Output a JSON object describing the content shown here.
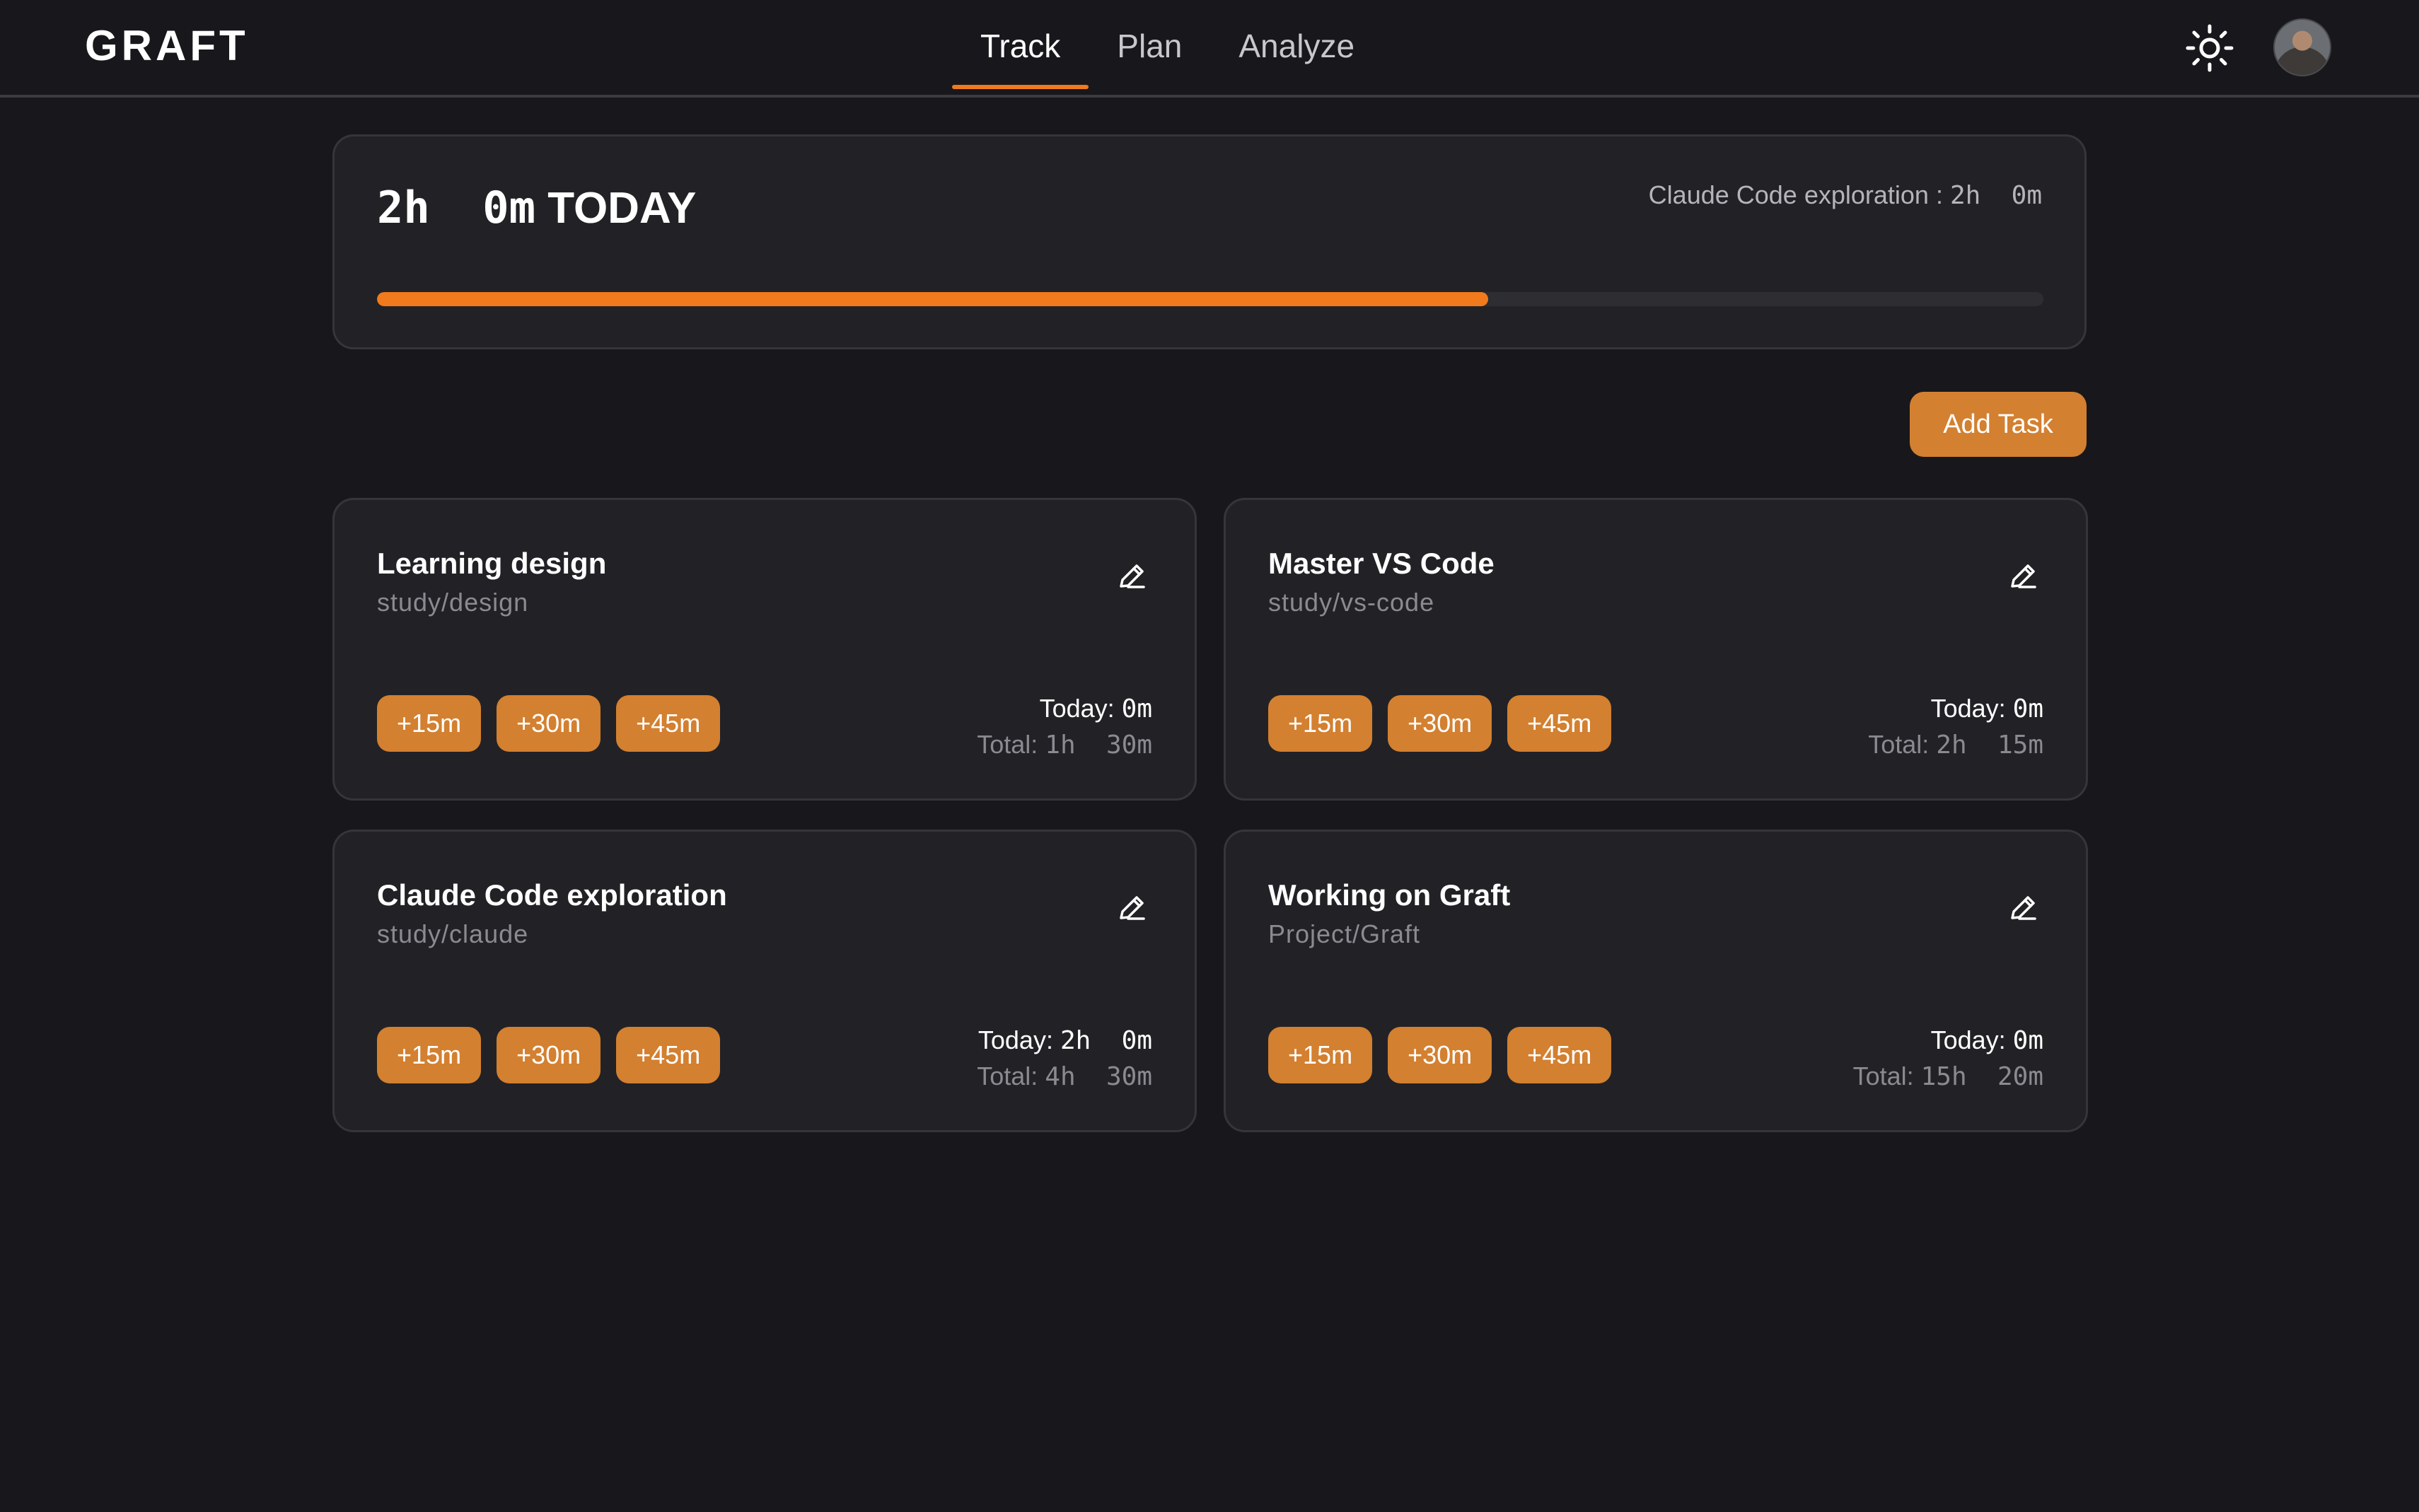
{
  "app": {
    "logo": "GRAFT"
  },
  "nav": {
    "tabs": [
      "Track",
      "Plan",
      "Analyze"
    ],
    "active": "Track"
  },
  "icons": {
    "theme": "sun-icon",
    "edit": "pencil-icon",
    "avatar": "user-avatar"
  },
  "colors": {
    "accent": "#f07a1c",
    "button": "#d38030",
    "background": "#18181c",
    "card": "#222226"
  },
  "summary": {
    "total": "2h  0m",
    "suffix": "TODAY",
    "current_label": "Claude Code exploration : ",
    "current_value": "2h  0m",
    "progress_fraction": 0.667
  },
  "actions": {
    "add_task": "Add Task"
  },
  "tasks": [
    {
      "title": "Learning design",
      "path": "study/design",
      "chips": [
        "+15m",
        "+30m",
        "+45m"
      ],
      "today_label": "Today: ",
      "today_value": "0m",
      "total_label": "Total: ",
      "total_value": "1h  30m"
    },
    {
      "title": "Master VS Code",
      "path": "study/vs-code",
      "chips": [
        "+15m",
        "+30m",
        "+45m"
      ],
      "today_label": "Today: ",
      "today_value": "0m",
      "total_label": "Total: ",
      "total_value": "2h  15m"
    },
    {
      "title": "Claude Code exploration",
      "path": "study/claude",
      "chips": [
        "+15m",
        "+30m",
        "+45m"
      ],
      "today_label": "Today: ",
      "today_value": "2h  0m",
      "total_label": "Total: ",
      "total_value": "4h  30m"
    },
    {
      "title": "Working on Graft",
      "path": "Project/Graft",
      "chips": [
        "+15m",
        "+30m",
        "+45m"
      ],
      "today_label": "Today: ",
      "today_value": "0m",
      "total_label": "Total: ",
      "total_value": "15h  20m"
    }
  ]
}
